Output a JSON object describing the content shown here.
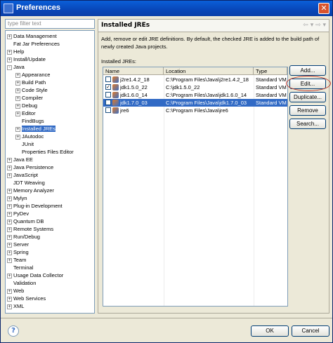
{
  "window": {
    "title": "Preferences",
    "close_label": "✕"
  },
  "filter": {
    "placeholder": "type filter text"
  },
  "tree": [
    {
      "label": "Data Management",
      "indent": 0,
      "exp": "+"
    },
    {
      "label": "Fat Jar Preferences",
      "indent": 0,
      "exp": ""
    },
    {
      "label": "Help",
      "indent": 0,
      "exp": "+"
    },
    {
      "label": "Install/Update",
      "indent": 0,
      "exp": "+"
    },
    {
      "label": "Java",
      "indent": 0,
      "exp": "-"
    },
    {
      "label": "Appearance",
      "indent": 1,
      "exp": "+"
    },
    {
      "label": "Build Path",
      "indent": 1,
      "exp": "+"
    },
    {
      "label": "Code Style",
      "indent": 1,
      "exp": "+"
    },
    {
      "label": "Compiler",
      "indent": 1,
      "exp": "+"
    },
    {
      "label": "Debug",
      "indent": 1,
      "exp": "+"
    },
    {
      "label": "Editor",
      "indent": 1,
      "exp": "+"
    },
    {
      "label": "FindBugs",
      "indent": 1,
      "exp": ""
    },
    {
      "label": "Installed JREs",
      "indent": 1,
      "exp": "+",
      "selected": true
    },
    {
      "label": "JAutodoc",
      "indent": 1,
      "exp": "+"
    },
    {
      "label": "JUnit",
      "indent": 1,
      "exp": ""
    },
    {
      "label": "Properties Files Editor",
      "indent": 1,
      "exp": ""
    },
    {
      "label": "Java EE",
      "indent": 0,
      "exp": "+"
    },
    {
      "label": "Java Persistence",
      "indent": 0,
      "exp": "+"
    },
    {
      "label": "JavaScript",
      "indent": 0,
      "exp": "+"
    },
    {
      "label": "JDT Weaving",
      "indent": 0,
      "exp": ""
    },
    {
      "label": "Memory Analyzer",
      "indent": 0,
      "exp": "+"
    },
    {
      "label": "Mylyn",
      "indent": 0,
      "exp": "+"
    },
    {
      "label": "Plug-in Development",
      "indent": 0,
      "exp": "+"
    },
    {
      "label": "PyDev",
      "indent": 0,
      "exp": "+"
    },
    {
      "label": "Quantum DB",
      "indent": 0,
      "exp": "+"
    },
    {
      "label": "Remote Systems",
      "indent": 0,
      "exp": "+"
    },
    {
      "label": "Run/Debug",
      "indent": 0,
      "exp": "+"
    },
    {
      "label": "Server",
      "indent": 0,
      "exp": "+"
    },
    {
      "label": "Spring",
      "indent": 0,
      "exp": "+"
    },
    {
      "label": "Team",
      "indent": 0,
      "exp": "+"
    },
    {
      "label": "Terminal",
      "indent": 0,
      "exp": ""
    },
    {
      "label": "Usage Data Collector",
      "indent": 0,
      "exp": "+"
    },
    {
      "label": "Validation",
      "indent": 0,
      "exp": ""
    },
    {
      "label": "Web",
      "indent": 0,
      "exp": "+"
    },
    {
      "label": "Web Services",
      "indent": 0,
      "exp": "+"
    },
    {
      "label": "XML",
      "indent": 0,
      "exp": "+"
    }
  ],
  "panel": {
    "heading": "Installed JREs",
    "nav": "⇦ ▾ ⇨ ▾",
    "description": "Add, remove or edit JRE definitions. By default, the checked JRE is added to the build path of newly created Java projects.",
    "jre_label": "Installed JREs:",
    "columns": [
      "Name",
      "Location",
      "Type"
    ],
    "rows": [
      {
        "name": "j2re1.4.2_18",
        "location": "C:\\Program Files\\Java\\j2re1.4.2_18",
        "type": "Standard VM",
        "checked": false,
        "selected": false
      },
      {
        "name": "jdk1.5.0_22",
        "location": "C:\\jdk1.5.0_22",
        "type": "Standard VM",
        "checked": true,
        "selected": false
      },
      {
        "name": "jdk1.6.0_14",
        "location": "C:\\Program Files\\Java\\jdk1.6.0_14",
        "type": "Standard VM",
        "checked": false,
        "selected": false
      },
      {
        "name": "jdk1.7.0_03",
        "location": "C:\\Program Files\\Java\\jdk1.7.0_03",
        "type": "Standard VM",
        "checked": false,
        "selected": true
      },
      {
        "name": "jre6",
        "location": "C:\\Program Files\\Java\\jre6",
        "type": "",
        "checked": false,
        "selected": false
      }
    ],
    "buttons": {
      "add": "Add...",
      "edit": "Edit...",
      "duplicate": "Duplicate...",
      "remove": "Remove",
      "search": "Search..."
    }
  },
  "footer": {
    "help": "?",
    "ok": "OK",
    "cancel": "Cancel"
  },
  "colors": {
    "selection": "#316ac5",
    "titlebar": "#0a5fd8",
    "annotation": "#c0392b"
  }
}
